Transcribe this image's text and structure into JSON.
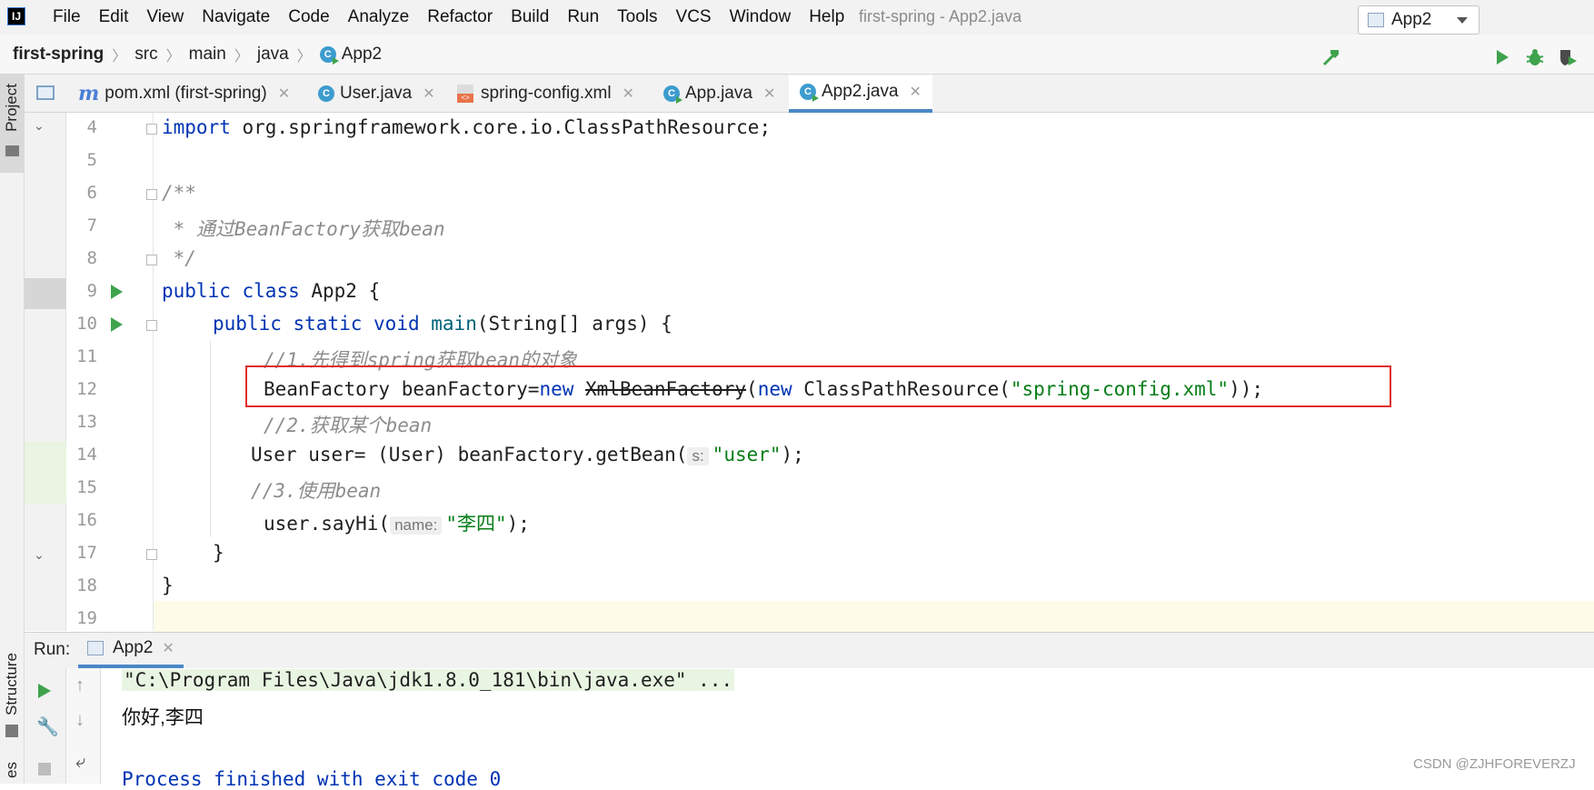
{
  "menubar": {
    "logo": "IJ",
    "items": [
      "File",
      "Edit",
      "View",
      "Navigate",
      "Code",
      "Analyze",
      "Refactor",
      "Build",
      "Run",
      "Tools",
      "VCS",
      "Window",
      "Help"
    ],
    "window_title": "first-spring - App2.java"
  },
  "breadcrumb": {
    "project": "first-spring",
    "src": "src",
    "main": "main",
    "java": "java",
    "cls": "App2"
  },
  "toolbar": {
    "run_config": "App2"
  },
  "side": {
    "project": "Project",
    "structure": "Structure",
    "other": "es"
  },
  "tabs": [
    {
      "label": "pom.xml (first-spring)",
      "icon": "maven-icon"
    },
    {
      "label": "User.java",
      "icon": "class-icon"
    },
    {
      "label": "spring-config.xml",
      "icon": "xml-file-icon"
    },
    {
      "label": "App.java",
      "icon": "run-class-icon"
    },
    {
      "label": "App2.java",
      "icon": "run-class-icon",
      "active": true
    }
  ],
  "editor": {
    "line_numbers": [
      "4",
      "5",
      "6",
      "7",
      "8",
      "9",
      "10",
      "11",
      "12",
      "13",
      "14",
      "15",
      "16",
      "17",
      "18",
      "19"
    ],
    "l4": {
      "kw": "import",
      "rest": " org.springframework.core.io.ClassPathResource;"
    },
    "l6": "/**",
    "l7": " * 通过BeanFactory获取bean",
    "l8": " */",
    "l9": {
      "kw1": "public",
      "kw2": "class",
      "rest": " App2 {"
    },
    "l10": {
      "kw1": "public",
      "kw2": "static",
      "kw3": "void",
      "fn": "main",
      "rest": "(String[] args) {"
    },
    "l11": "//1.先得到spring获取bean的对象",
    "l12": {
      "a": "BeanFactory beanFactory=",
      "kw1": "new",
      "deprecated": "XmlBeanFactory",
      "b": "(",
      "kw2": "new",
      "c": " ClassPathResource(",
      "str": "\"spring-config.xml\"",
      "d": "));"
    },
    "l13": "//2.获取某个bean",
    "l14": {
      "a": "User user= (User) beanFactory.getBean(",
      "hint": "s:",
      "str": "\"user\"",
      "b": ");"
    },
    "l15": "//3.使用bean",
    "l16": {
      "a": "user.sayHi(",
      "hint": "name:",
      "str": "\"李四\"",
      "b": ");"
    },
    "l17": "}",
    "l18": "}"
  },
  "run": {
    "label": "Run:",
    "tab": "App2",
    "cmd": "\"C:\\Program Files\\Java\\jdk1.8.0_181\\bin\\java.exe\" ...",
    "output": "你好,李四",
    "exit": "Process finished with exit code 0"
  },
  "watermark": "CSDN @ZJHFOREVERZJ",
  "colors": {
    "keyword": "#0033b3",
    "string": "#067d17",
    "comment": "#8c8c8c",
    "highlight_box": "#e02e2e",
    "run_green": "#3fa34d"
  }
}
